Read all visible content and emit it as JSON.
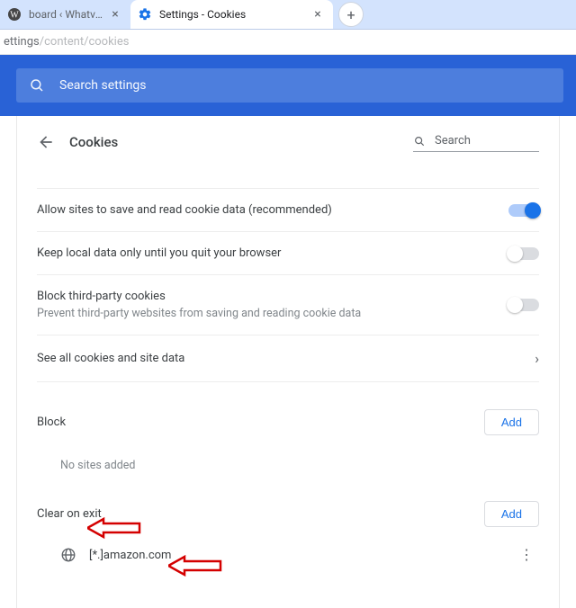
{
  "tabs": {
    "inactive": {
      "title": "board ‹ Whatvwant — Wor"
    },
    "active": {
      "title": "Settings - Cookies"
    }
  },
  "omnibox": {
    "head": "ettings",
    "tail": "/content/cookies"
  },
  "settings_search_placeholder": "Search settings",
  "page": {
    "title": "Cookies",
    "search_placeholder": "Search",
    "rows": {
      "allow": {
        "label": "Allow sites to save and read cookie data (recommended)"
      },
      "keep": {
        "label": "Keep local data only until you quit your browser"
      },
      "third": {
        "label": "Block third-party cookies",
        "sub": "Prevent third-party websites from saving and reading cookie data"
      },
      "seeall": {
        "label": "See all cookies and site data"
      }
    },
    "sections": {
      "block": {
        "title": "Block",
        "add": "Add",
        "empty": "No sites added"
      },
      "clear_on_exit": {
        "title": "Clear on exit",
        "add": "Add",
        "site": "[*.]amazon.com"
      }
    }
  }
}
